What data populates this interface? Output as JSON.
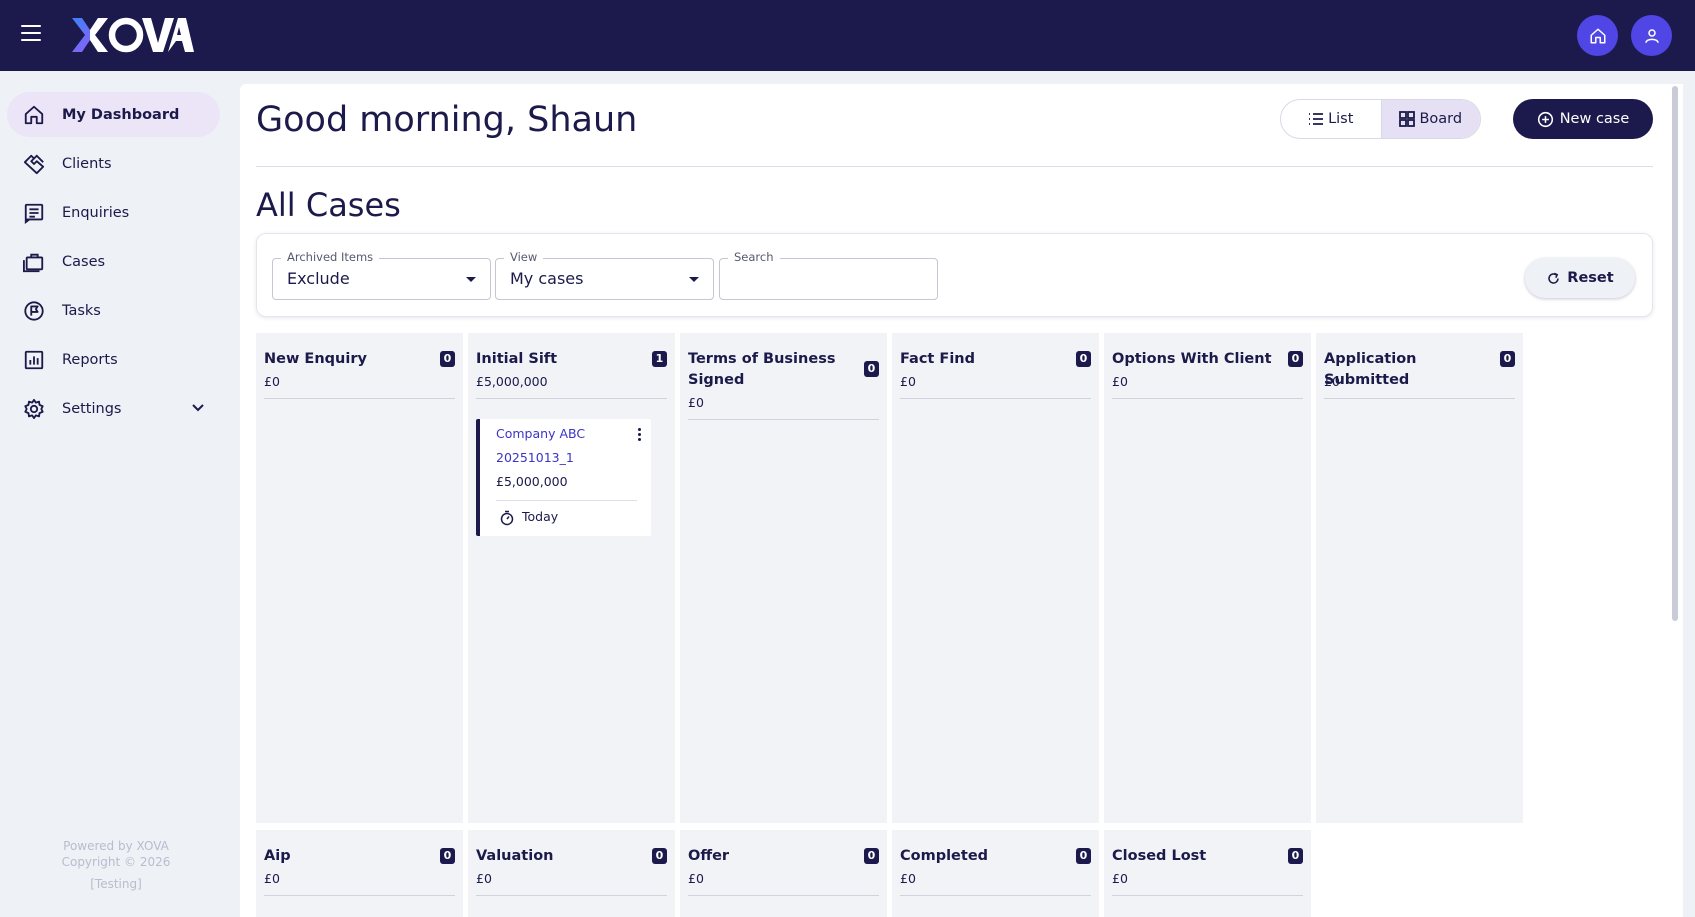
{
  "app": {
    "logo": "XOVA",
    "icons": {
      "home": "home-icon",
      "profile": "user-icon",
      "menu": "hamburger-icon"
    }
  },
  "sidebar": {
    "items": [
      {
        "label": "My Dashboard",
        "icon": "home-icon",
        "active": true
      },
      {
        "label": "Clients",
        "icon": "handshake-icon"
      },
      {
        "label": "Enquiries",
        "icon": "enquiries-icon"
      },
      {
        "label": "Cases",
        "icon": "briefcase-icon"
      },
      {
        "label": "Tasks",
        "icon": "tasks-icon"
      },
      {
        "label": "Reports",
        "icon": "reports-icon"
      },
      {
        "label": "Settings",
        "icon": "gear-icon",
        "expandable": true
      }
    ],
    "footer": {
      "powered": "Powered by XOVA",
      "copyright": "Copyright © 2026",
      "env": "[Testing]"
    }
  },
  "header": {
    "greeting": "Good morning, Shaun",
    "view_toggle": {
      "list_label": "List",
      "board_label": "Board",
      "selected": "Board"
    },
    "new_case_label": "New case"
  },
  "section_title": "All Cases",
  "filters": {
    "archived": {
      "label": "Archived Items",
      "value": "Exclude"
    },
    "view": {
      "label": "View",
      "value": "My cases"
    },
    "search": {
      "label": "Search",
      "value": ""
    },
    "reset_label": "Reset"
  },
  "board": {
    "columns": [
      {
        "title": "New Enquiry",
        "count": "0",
        "total": "£0"
      },
      {
        "title": "Initial Sift",
        "count": "1",
        "total": "£5,000,000"
      },
      {
        "title": "Terms of Business Signed",
        "count": "0",
        "total": "£0"
      },
      {
        "title": "Fact Find",
        "count": "0",
        "total": "£0"
      },
      {
        "title": "Options With Client",
        "count": "0",
        "total": "£0"
      },
      {
        "title": "Application Submitted",
        "count": "0",
        "total": "£0"
      },
      {
        "title": "Aip",
        "count": "0",
        "total": "£0"
      },
      {
        "title": "Valuation",
        "count": "0",
        "total": "£0"
      },
      {
        "title": "Offer",
        "count": "0",
        "total": "£0"
      },
      {
        "title": "Completed",
        "count": "0",
        "total": "£0"
      },
      {
        "title": "Closed Lost",
        "count": "0",
        "total": "£0"
      }
    ],
    "cards": [
      {
        "column": "Initial Sift",
        "company": "Company ABC",
        "ref": "20251013_1",
        "amount": "£5,000,000",
        "due": "Today"
      }
    ]
  },
  "colors": {
    "navy": "#1c1a4c",
    "accent": "#4f46e5",
    "link": "#3b34c4",
    "active_nav": "#ece5f8"
  }
}
